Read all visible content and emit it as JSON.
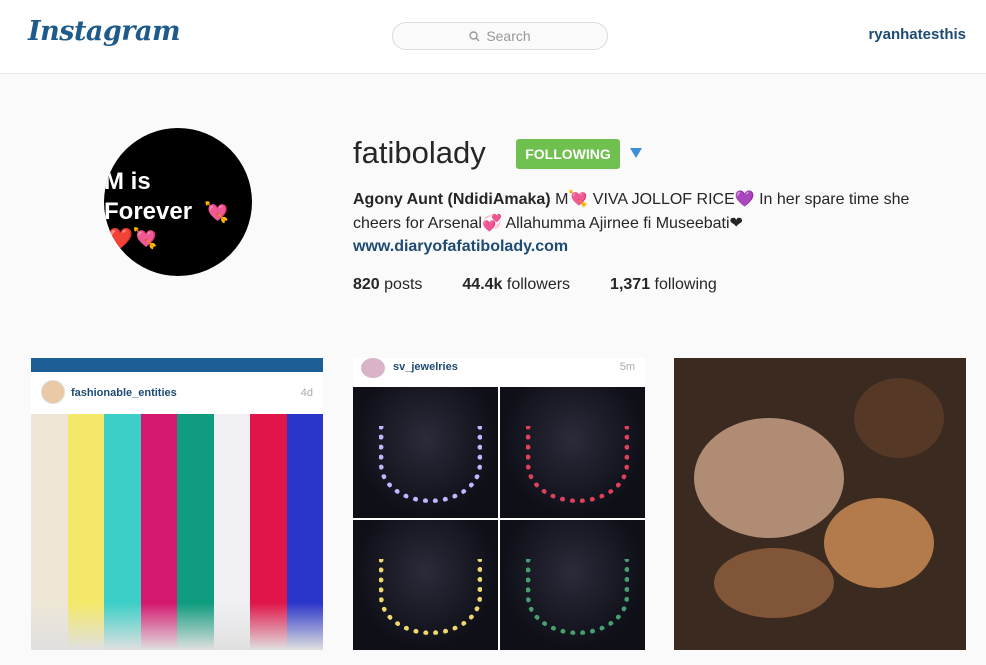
{
  "header": {
    "logo": "Instagram",
    "search_placeholder": "Search",
    "current_user": "ryanhatesthis"
  },
  "profile": {
    "avatar_text_line1": "M is",
    "avatar_text_line2": "Forever",
    "username": "fatibolady",
    "follow_button": "Following",
    "bio_name": "Agony Aunt (NdidiAmaka)",
    "bio_line1": " M💘 VIVA JOLLOF RICE💜 In her spare time she cheers for Arsenal💞 Allahumma Ajirnee fi Museebati❤",
    "website": "www.diaryofafatibolady.com",
    "stats": {
      "posts_count": "820",
      "posts_label": "posts",
      "followers_count": "44.4k",
      "followers_label": "followers",
      "following_count": "1,371",
      "following_label": "following"
    }
  },
  "posts": [
    {
      "account": "fashionable_entities",
      "time": "4d",
      "fabric_colors": [
        "#ede6d6",
        "#f4e86a",
        "#3ccfc7",
        "#d4186f",
        "#0e9b7e",
        "#f0f0f4",
        "#e1154a",
        "#2a36c8"
      ]
    },
    {
      "account": "sv_jewelries",
      "time": "5m"
    },
    {
      "account": "",
      "time": ""
    }
  ],
  "colors": {
    "follow_green": "#70c050",
    "link_blue": "#1e4b73"
  }
}
